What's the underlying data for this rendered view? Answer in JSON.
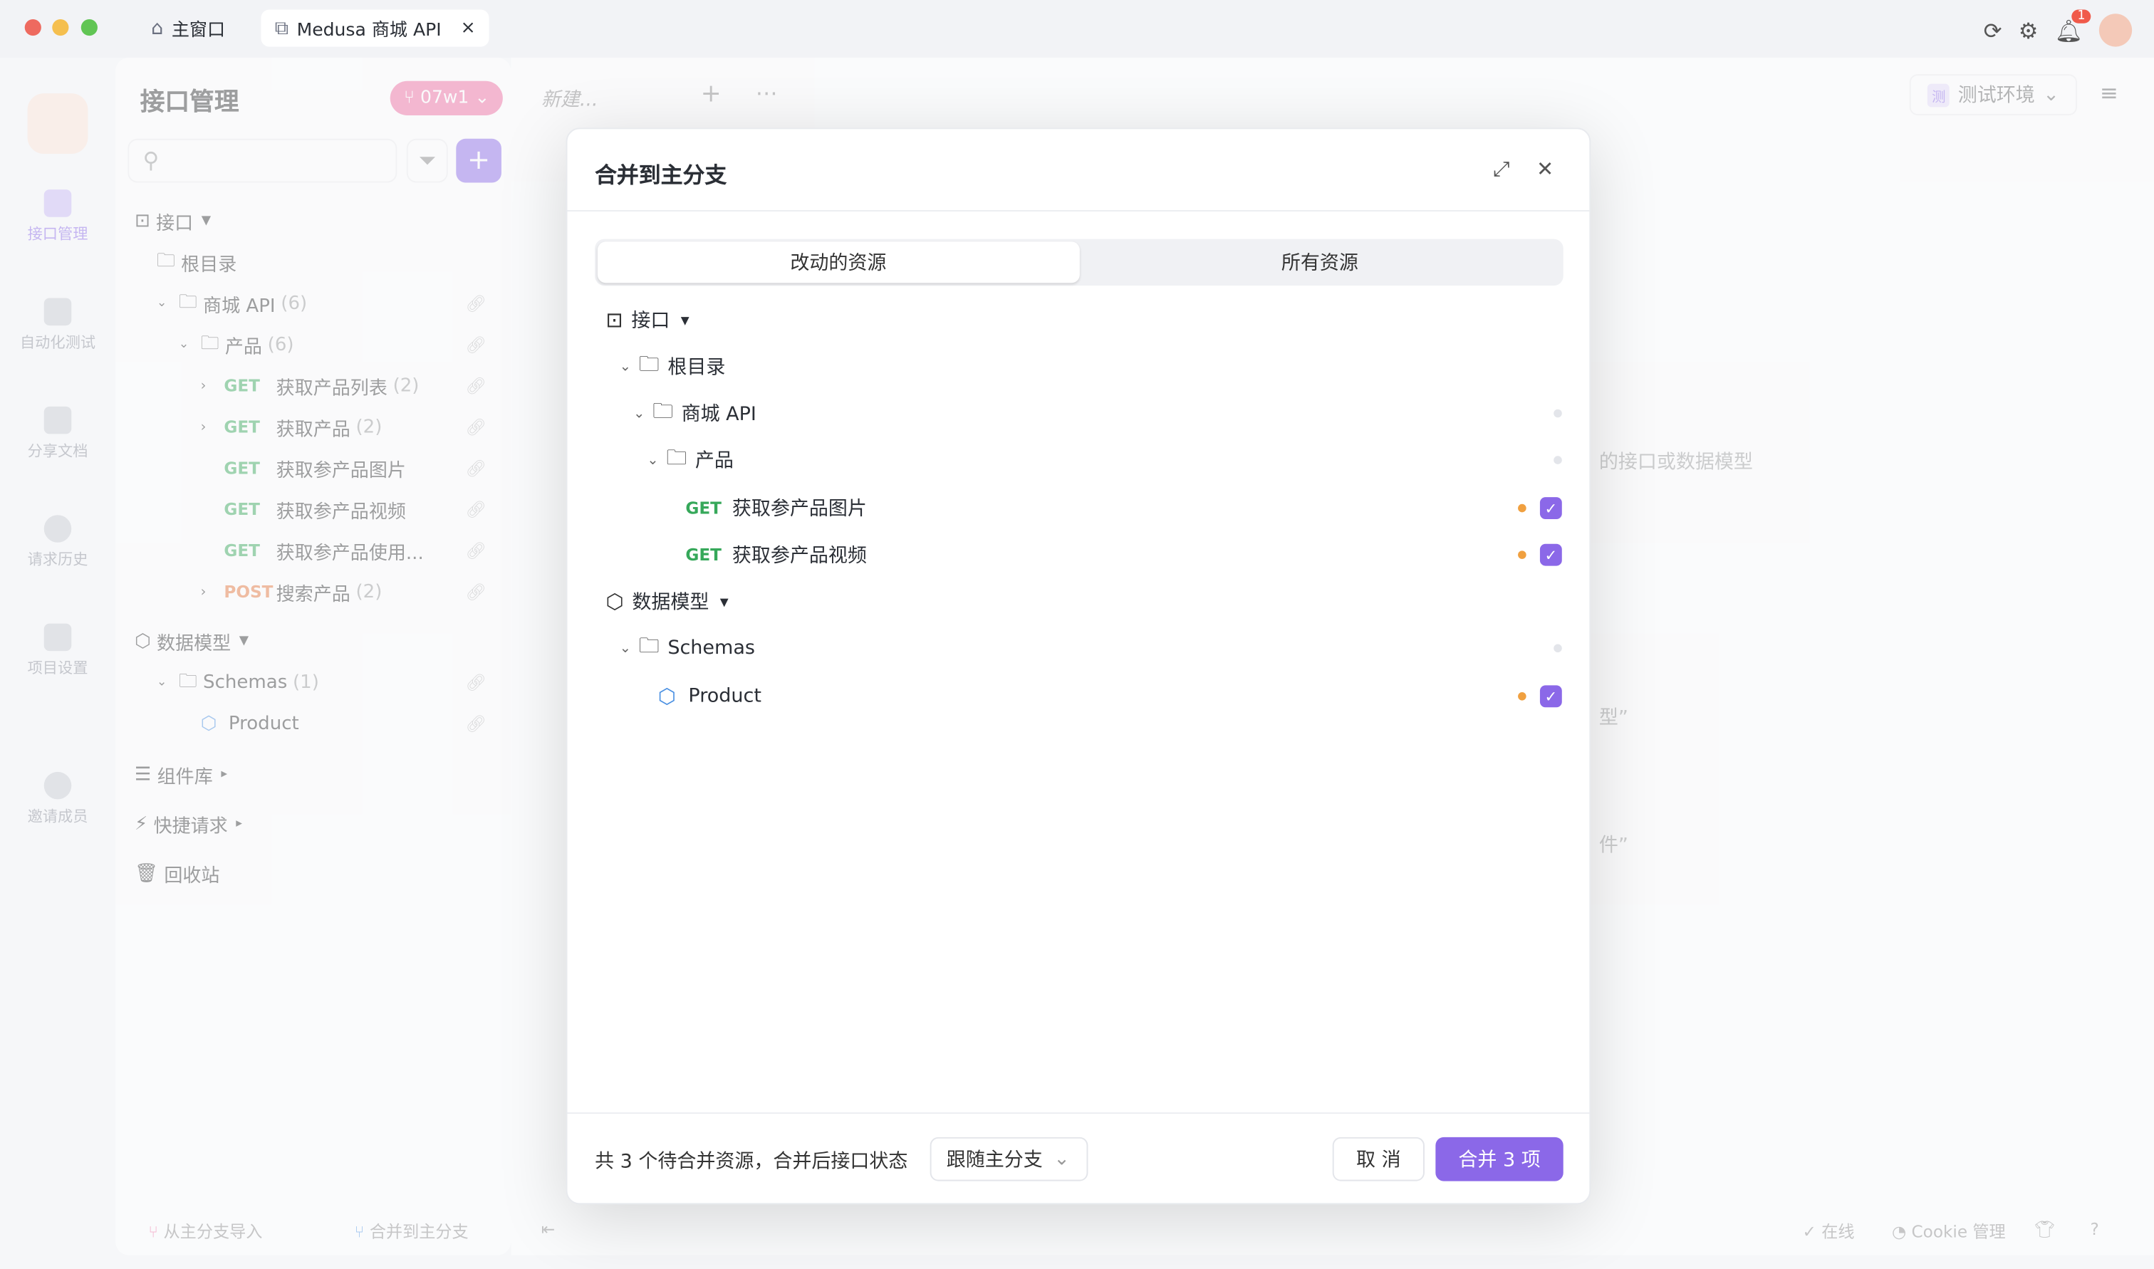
{
  "titlebar": {
    "tabs": [
      {
        "label": "主窗口",
        "icon": "home-icon"
      },
      {
        "label": "Medusa 商城 API",
        "icon": "external-window-icon",
        "close": "×"
      }
    ],
    "notification_count": "1"
  },
  "leftnav": {
    "items": [
      {
        "label": "接口管理"
      },
      {
        "label": "自动化测试"
      },
      {
        "label": "分享文档"
      },
      {
        "label": "请求历史"
      },
      {
        "label": "项目设置"
      },
      {
        "label": "邀请成员"
      }
    ]
  },
  "sidebar": {
    "title": "接口管理",
    "branch": "07w1",
    "tree": [
      {
        "label": "接口",
        "kind": "section"
      },
      {
        "label": "根目录",
        "kind": "folder"
      },
      {
        "label": "商城 API",
        "count": "(6)",
        "kind": "folder"
      },
      {
        "label": "产品",
        "count": "(6)",
        "kind": "folder"
      },
      {
        "method": "GET",
        "label": "获取产品列表",
        "count": "(2)"
      },
      {
        "method": "GET",
        "label": "获取产品",
        "count": "(2)"
      },
      {
        "method": "GET",
        "label": "获取参产品图片"
      },
      {
        "method": "GET",
        "label": "获取参产品视频"
      },
      {
        "method": "GET",
        "label": "获取参产品使用..."
      },
      {
        "method": "POST",
        "label": "搜索产品",
        "count": "(2)"
      },
      {
        "label": "数据模型",
        "kind": "section"
      },
      {
        "label": "Schemas",
        "count": "(1)",
        "kind": "folder"
      },
      {
        "label": "Product",
        "kind": "schema"
      },
      {
        "label": "组件库",
        "kind": "section"
      },
      {
        "label": "快捷请求",
        "kind": "section"
      },
      {
        "label": "回收站",
        "kind": "section"
      }
    ]
  },
  "main": {
    "new_tab": "新建...",
    "env": "测试环境",
    "env_badge": "测",
    "bg_text1": "的接口或数据模型",
    "bg_text2": "型”",
    "bg_text3": "件”"
  },
  "dialog": {
    "title": "合并到主分支",
    "tabs": [
      "改动的资源",
      "所有资源"
    ],
    "tree": [
      {
        "label": "接口",
        "icon": "api-icon"
      },
      {
        "label": "根目录"
      },
      {
        "label": "商城 API"
      },
      {
        "label": "产品"
      },
      {
        "method": "GET",
        "label": "获取参产品图片",
        "checked": true
      },
      {
        "method": "GET",
        "label": "获取参产品视频",
        "checked": true
      },
      {
        "label": "数据模型",
        "icon": "cube-icon"
      },
      {
        "label": "Schemas"
      },
      {
        "label": "Product",
        "checked": true
      }
    ],
    "summary": "共 3 个待合并资源，合并后接口状态",
    "status_select": "跟随主分支",
    "cancel": "取 消",
    "confirm": "合并 3 项"
  },
  "bottombar": {
    "import": "从主分支导入",
    "merge": "合并到主分支",
    "online": "在线",
    "cookie": "Cookie 管理"
  },
  "colors": {
    "accent": "#8b68e8",
    "get": "#36a85a",
    "post": "#e8763a",
    "changed_dot": "#f0a040"
  }
}
